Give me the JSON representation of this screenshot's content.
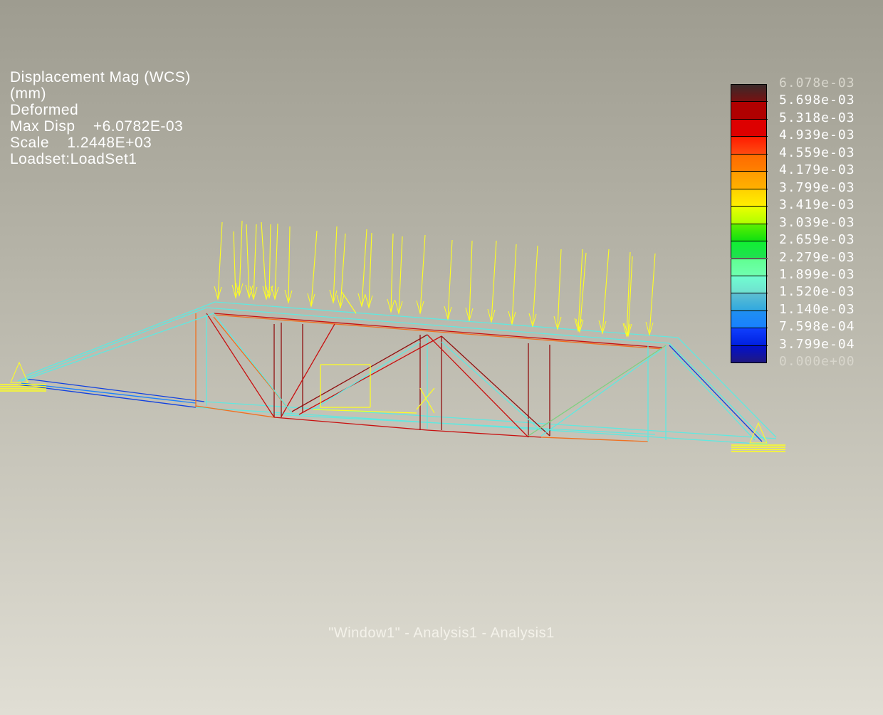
{
  "info": {
    "line1": "Displacement Mag (WCS)",
    "line2": "(mm)",
    "line3": "Deformed",
    "line4": "Max Disp    +6.0782E-03",
    "line5": "Scale    1.2448E+03",
    "line6": "Loadset:LoadSet1"
  },
  "legend": {
    "labels": [
      "6.078e-03",
      "5.698e-03",
      "5.318e-03",
      "4.939e-03",
      "4.559e-03",
      "4.179e-03",
      "3.799e-03",
      "3.419e-03",
      "3.039e-03",
      "2.659e-03",
      "2.279e-03",
      "1.899e-03",
      "1.520e-03",
      "1.140e-03",
      "7.598e-04",
      "3.799e-04",
      "0.000e+00"
    ],
    "colors": [
      [
        "#3a2a2a",
        "#7a1010"
      ],
      [
        "#b00000",
        "#b00000"
      ],
      [
        "#dd0000",
        "#dd0000"
      ],
      [
        "#ff1a00",
        "#ff4a10"
      ],
      [
        "#ff6a00",
        "#ff8000"
      ],
      [
        "#ff9a00",
        "#ffb000"
      ],
      [
        "#ffd000",
        "#ffee00"
      ],
      [
        "#eeff00",
        "#b0ff00"
      ],
      [
        "#60f000",
        "#10e010"
      ],
      [
        "#10f030",
        "#20e050"
      ],
      [
        "#60ff90",
        "#70ffb0"
      ],
      [
        "#70ffd0",
        "#70e0d0"
      ],
      [
        "#60c0d0",
        "#30a8e0"
      ],
      [
        "#2090f0",
        "#1880ff"
      ],
      [
        "#1040ff",
        "#0020e0"
      ],
      [
        "#0010d0",
        "#201880"
      ]
    ]
  },
  "caption": "\"Window1\"  -  Analysis1  -  Analysis1"
}
